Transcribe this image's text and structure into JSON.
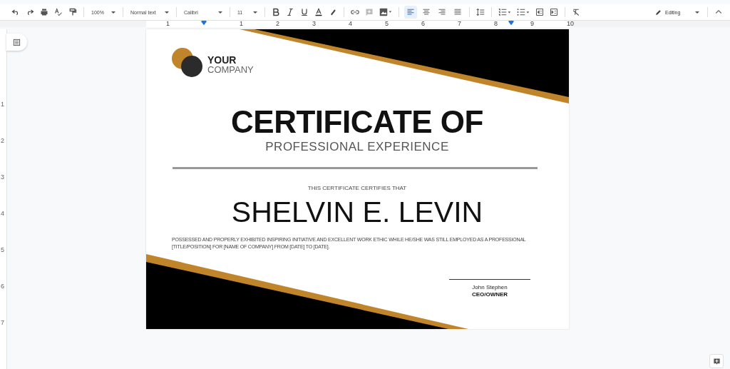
{
  "toolbar": {
    "zoom": "100%",
    "paragraph_style": "Normal text",
    "font": "Calibri",
    "font_size": "11",
    "align_buttons": [
      {
        "kind": "left",
        "selected": true
      },
      {
        "kind": "center",
        "selected": false
      },
      {
        "kind": "right",
        "selected": false
      },
      {
        "kind": "justify",
        "selected": false
      }
    ],
    "mode": "Editing"
  },
  "ruler": {
    "labels": [
      "1",
      "1",
      "2",
      "3",
      "4",
      "5",
      "6",
      "7",
      "8",
      "9",
      "10"
    ]
  },
  "vertical_ruler": {
    "labels": [
      "1",
      "2",
      "3",
      "4",
      "5",
      "6",
      "7"
    ]
  },
  "certificate": {
    "logo_line_1": "YOUR",
    "logo_line_2": "COMPANY",
    "title": "CERTIFICATE OF",
    "subtitle": "PROFESSIONAL EXPERIENCE",
    "intro": "THIS CERTIFICATE CERTIFIES THAT",
    "recipient": "SHELVIN E. LEVIN",
    "body": "POSSESSED AND PROPERLY EXHIBITED INSPIRING INITIATIVE AND EXCELLENT WORK ETHIC WHILE HE/SHE WAS STILL EMPLOYED AS A PROFESSIONAL [TITLE/POSITION] FOR [NAME OF COMPANY] FROM [DATE] TO [DATE].",
    "signer_name": "John Stephen",
    "signer_title": "CEO/OWNER"
  }
}
